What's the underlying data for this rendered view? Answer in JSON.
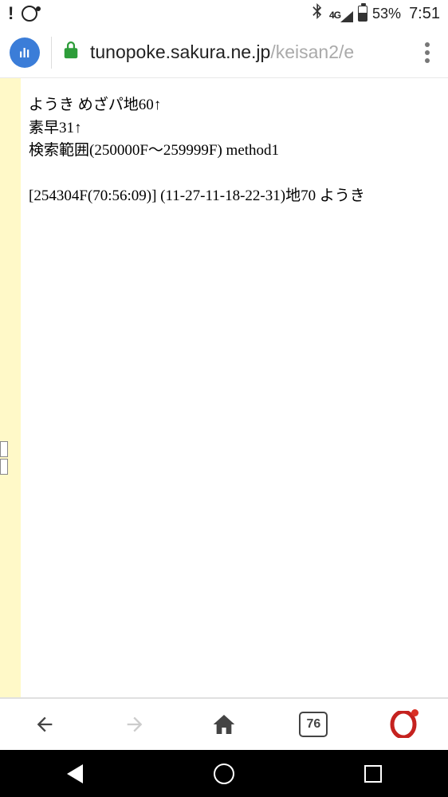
{
  "status": {
    "battery_pct": "53%",
    "time": "7:51",
    "network": "4G"
  },
  "browser": {
    "url_host": "tunopoke.sakura.ne.jp",
    "url_path": "/keisan2/e",
    "tab_count": "76"
  },
  "page": {
    "line1": "ようき めざパ地60↑",
    "line2": "素早31↑",
    "line3": "検索範囲(250000F〜259999F) method1",
    "line4": "[254304F(70:56:09)] (11-27-11-18-22-31)地70 ようき"
  }
}
